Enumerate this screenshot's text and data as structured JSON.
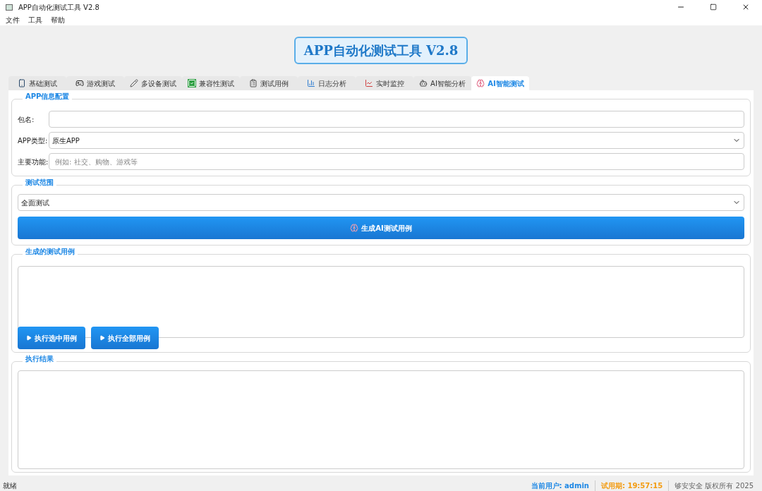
{
  "window": {
    "title": "APP自动化测试工具 V2.8"
  },
  "menu": [
    "文件",
    "工具",
    "帮助"
  ],
  "header": {
    "title": "APP自动化测试工具 V2.8"
  },
  "tabs": [
    {
      "label": "基础测试",
      "selected": false
    },
    {
      "label": "游戏测试",
      "selected": false
    },
    {
      "label": "多设备测试",
      "selected": false
    },
    {
      "label": "兼容性测试",
      "selected": false
    },
    {
      "label": "测试用例",
      "selected": false
    },
    {
      "label": "日志分析",
      "selected": false
    },
    {
      "label": "实时监控",
      "selected": false
    },
    {
      "label": "AI智能分析",
      "selected": false
    },
    {
      "label": "AI智能测试",
      "selected": true
    }
  ],
  "app_info": {
    "title": "APP信息配置",
    "fields": [
      {
        "label": "包名:",
        "kind": "input"
      },
      {
        "label": "APP类型:",
        "kind": "select",
        "value": "原生APP"
      },
      {
        "label": "主要功能:",
        "kind": "input",
        "placeholder": "例如: 社交、购物、游戏等"
      }
    ]
  },
  "test_scope": {
    "title": "测试范围",
    "value": "全面测试",
    "button": "生成AI测试用例"
  },
  "generated_cases": {
    "title": "生成的测试用例",
    "buttons": [
      "执行选中用例",
      "执行全部用例"
    ]
  },
  "results": {
    "title": "执行结果"
  },
  "status_bar": {
    "message": "就绪",
    "user_label": "当前用户: admin",
    "trial": "试用期: 19:57:15",
    "copyright": "够安安全 版权所有 2025"
  }
}
